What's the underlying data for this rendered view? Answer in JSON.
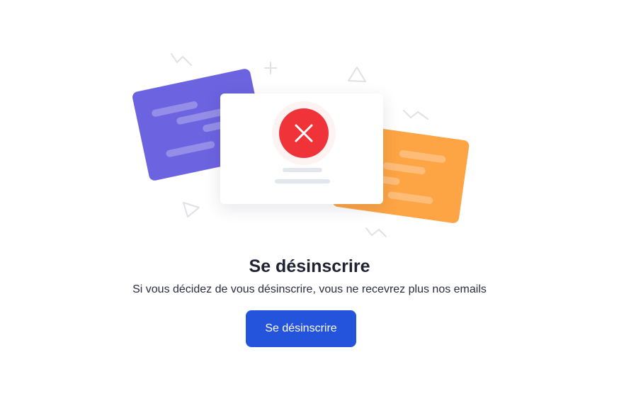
{
  "main": {
    "title": "Se désinscrire",
    "subtitle": "Si vous décidez de vous désinscrire, vous ne recevrez plus nos emails",
    "button_label": "Se désinscrire"
  },
  "illustration": {
    "icon": "close-icon",
    "colors": {
      "purple_card": "#6c63e0",
      "orange_card": "#fda444",
      "error_circle": "#f03338",
      "button": "#2453dc"
    }
  }
}
